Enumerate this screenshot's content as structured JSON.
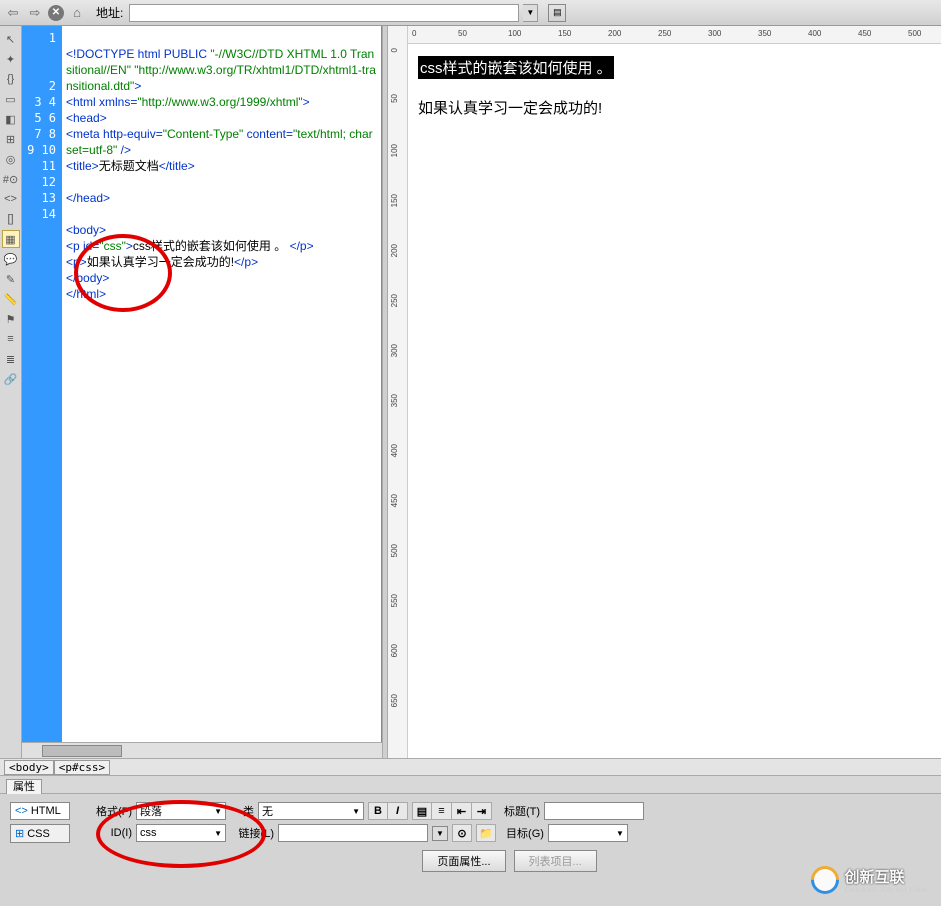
{
  "topbar": {
    "addr_label": "地址:",
    "addr_value": ""
  },
  "code": {
    "lines": [
      "1",
      "2",
      "3",
      "4",
      "5",
      "6",
      "7",
      "8",
      "9",
      "10",
      "11",
      "12",
      "13",
      "14"
    ],
    "l1a": "<!DOCTYPE html PUBLIC ",
    "l1b": "\"-//W3C//DTD XHTML 1.0 Transitional//EN\" \"http://www.w3.org/TR/xhtml1/DTD/xhtml1-transitional.dtd\"",
    "l1c": ">",
    "l2a": "<html xmlns=",
    "l2b": "\"http://www.w3.org/1999/xhtml\"",
    "l2c": ">",
    "l3": "<head>",
    "l4a": "<meta http-equiv=",
    "l4b": "\"Content-Type\"",
    "l4c": " content=",
    "l4d": "\"text/html; charset=utf-8\"",
    "l4e": " />",
    "l5a": "<title>",
    "l5b": "无标题文档",
    "l5c": "</title>",
    "l7": "</head>",
    "l9": "<body>",
    "l10a": "<p id=",
    "l10b": "\"css\"",
    "l10c": ">",
    "l10d": "css样式的嵌套该如何使用 。 ",
    "l10e": "</p>",
    "l11a": "<p>",
    "l11b": "如果认真学习一定会成功的!",
    "l11c": "</p>",
    "l12": "</body>",
    "l13": "</html>"
  },
  "ruler_h": [
    "0",
    "50",
    "100",
    "150",
    "200",
    "250",
    "300",
    "350",
    "400",
    "450",
    "500"
  ],
  "ruler_v": [
    "0",
    "50",
    "100",
    "150",
    "200",
    "250",
    "300",
    "350",
    "400",
    "450",
    "500",
    "550",
    "600",
    "650"
  ],
  "preview": {
    "highlighted": "css样式的嵌套该如何使用 。",
    "text2": "如果认真学习一定会成功的!"
  },
  "breadcrumb": {
    "a": "<body>",
    "b": "<p#css>"
  },
  "tabs": {
    "props": "属性"
  },
  "props": {
    "html_btn": "HTML",
    "css_btn": "CSS",
    "format_label": "格式(F)",
    "format_value": "段落",
    "id_label": "ID(I)",
    "id_value": "css",
    "class_label": "类",
    "class_value": "无",
    "link_label": "链接(L)",
    "link_value": "",
    "title_label": "标题(T)",
    "title_value": "",
    "target_label": "目标(G)",
    "target_value": "",
    "page_props": "页面属性...",
    "list_items": "列表项目..."
  },
  "watermark": {
    "main": "创新互联",
    "sub": "CHUANG XIN HU LIAN"
  }
}
